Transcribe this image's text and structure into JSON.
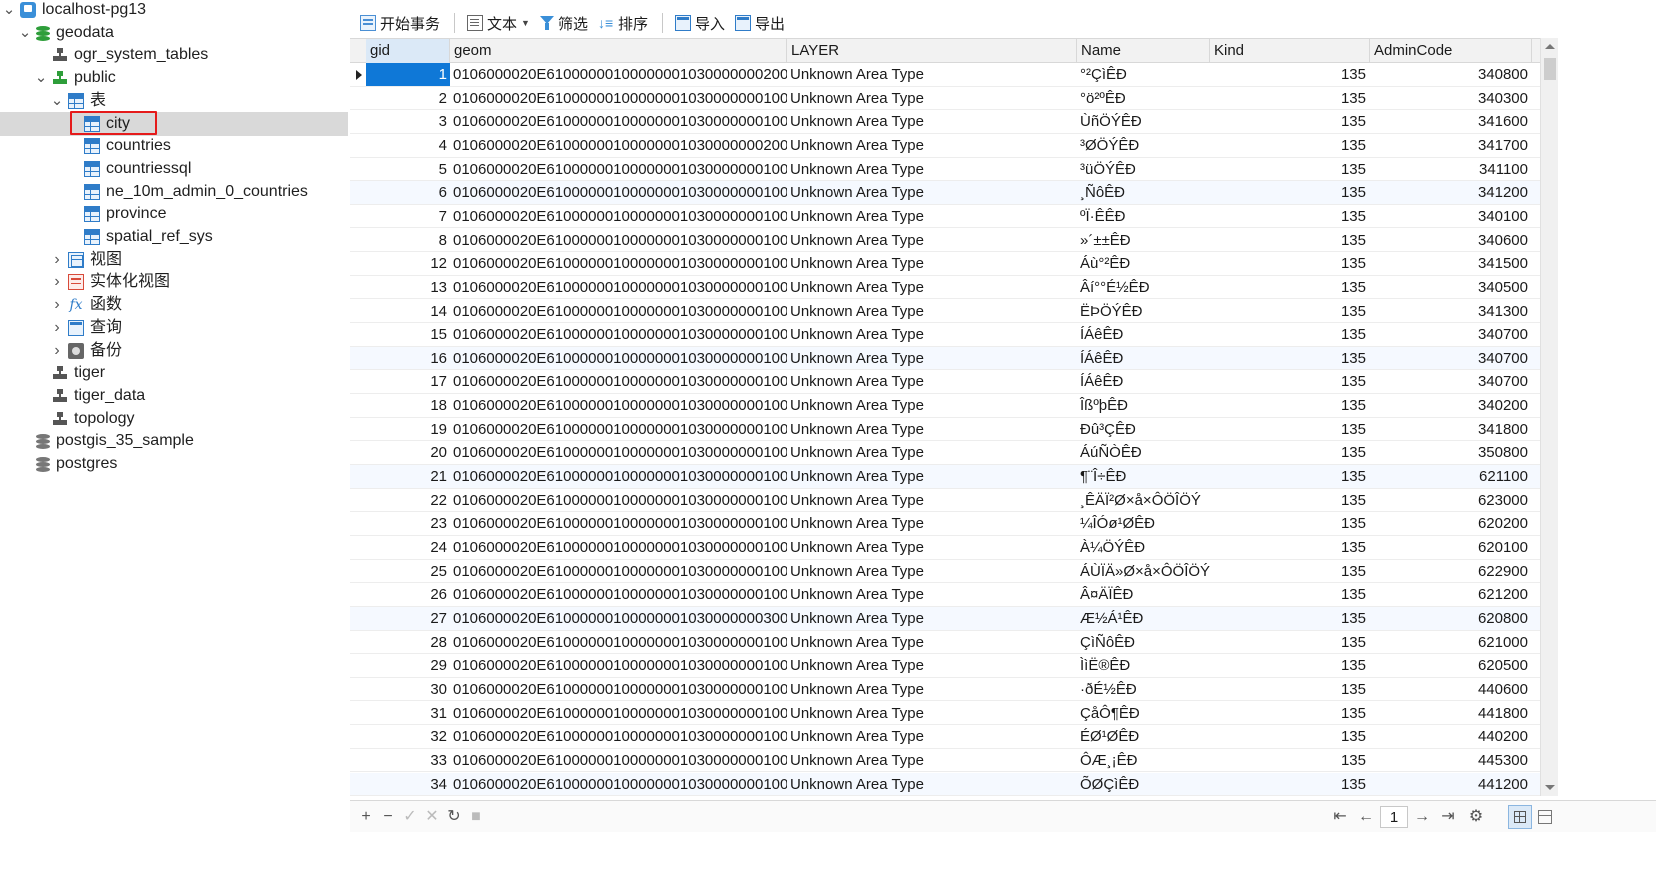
{
  "tree": [
    {
      "label": "localhost-pg13",
      "icon": "server-icon",
      "level": 0,
      "expanded": true
    },
    {
      "label": "geodata",
      "icon": "database-icon",
      "level": 1,
      "expanded": true,
      "color": "#2e9e3a"
    },
    {
      "label": "ogr_system_tables",
      "icon": "schema-icon",
      "level": 2,
      "expanded": null,
      "color": "#555555"
    },
    {
      "label": "public",
      "icon": "schema-icon",
      "level": 2,
      "expanded": true,
      "color": "#2e9e3a"
    },
    {
      "label": "表",
      "icon": "tables-folder-icon",
      "level": 3,
      "expanded": true
    },
    {
      "label": "city",
      "icon": "table-icon",
      "level": 4,
      "expanded": null,
      "selected": true
    },
    {
      "label": "countries",
      "icon": "table-icon",
      "level": 4,
      "expanded": null
    },
    {
      "label": "countriessql",
      "icon": "table-icon",
      "level": 4,
      "expanded": null
    },
    {
      "label": "ne_10m_admin_0_countries",
      "icon": "table-icon",
      "level": 4,
      "expanded": null
    },
    {
      "label": "province",
      "icon": "table-icon",
      "level": 4,
      "expanded": null
    },
    {
      "label": "spatial_ref_sys",
      "icon": "table-icon",
      "level": 4,
      "expanded": null
    },
    {
      "label": "视图",
      "icon": "view-icon",
      "level": 3,
      "expanded": false
    },
    {
      "label": "实体化视图",
      "icon": "materialized-view-icon",
      "level": 3,
      "expanded": false
    },
    {
      "label": "函数",
      "icon": "function-icon",
      "level": 3,
      "expanded": false
    },
    {
      "label": "查询",
      "icon": "query-icon",
      "level": 3,
      "expanded": false
    },
    {
      "label": "备份",
      "icon": "backup-icon",
      "level": 3,
      "expanded": false
    },
    {
      "label": "tiger",
      "icon": "schema-icon",
      "level": 2,
      "expanded": null,
      "color": "#555555"
    },
    {
      "label": "tiger_data",
      "icon": "schema-icon",
      "level": 2,
      "expanded": null,
      "color": "#555555"
    },
    {
      "label": "topology",
      "icon": "schema-icon",
      "level": 2,
      "expanded": null,
      "color": "#555555"
    },
    {
      "label": "postgis_35_sample",
      "icon": "database-icon",
      "level": 1,
      "expanded": null,
      "color": "#777777"
    },
    {
      "label": "postgres",
      "icon": "database-icon",
      "level": 1,
      "expanded": null,
      "color": "#777777"
    }
  ],
  "toolbar": {
    "begin_transaction": "开始事务",
    "text": "文本",
    "filter": "筛选",
    "sort": "排序",
    "import": "导入",
    "export": "导出"
  },
  "columns": [
    "gid",
    "geom",
    "LAYER",
    "Name",
    "Kind",
    "AdminCode"
  ],
  "rows": [
    [
      "1",
      "0106000020E61000000100000001030000000200",
      "Unknown Area Type",
      "°²ÇìÊÐ",
      "135",
      "340800"
    ],
    [
      "2",
      "0106000020E61000000100000001030000000100",
      "Unknown Area Type",
      "°ö²ºÊÐ",
      "135",
      "340300"
    ],
    [
      "3",
      "0106000020E61000000100000001030000000100",
      "Unknown Area Type",
      "ÙñÖÝÊÐ",
      "135",
      "341600"
    ],
    [
      "4",
      "0106000020E61000000100000001030000000200",
      "Unknown Area Type",
      "³ØÖÝÊÐ",
      "135",
      "341700"
    ],
    [
      "5",
      "0106000020E61000000100000001030000000100",
      "Unknown Area Type",
      "³üÖÝÊÐ",
      "135",
      "341100"
    ],
    [
      "6",
      "0106000020E61000000100000001030000000100",
      "Unknown Area Type",
      "¸ÑôÊÐ",
      "135",
      "341200"
    ],
    [
      "7",
      "0106000020E61000000100000001030000000100",
      "Unknown Area Type",
      "ºÏ·ÊÊÐ",
      "135",
      "340100"
    ],
    [
      "8",
      "0106000020E61000000100000001030000000100",
      "Unknown Area Type",
      "»´±±ÊÐ",
      "135",
      "340600"
    ],
    [
      "12",
      "0106000020E61000000100000001030000000100",
      "Unknown Area Type",
      "Áù°²ÊÐ",
      "135",
      "341500"
    ],
    [
      "13",
      "0106000020E61000000100000001030000000100",
      "Unknown Area Type",
      "Âí°°É½ÊÐ",
      "135",
      "340500"
    ],
    [
      "14",
      "0106000020E61000000100000001030000000100",
      "Unknown Area Type",
      "ËÞÖÝÊÐ",
      "135",
      "341300"
    ],
    [
      "15",
      "0106000020E61000000100000001030000000100",
      "Unknown Area Type",
      "Í­ÁêÊÐ",
      "135",
      "340700"
    ],
    [
      "16",
      "0106000020E61000000100000001030000000100",
      "Unknown Area Type",
      "Í­ÁêÊÐ",
      "135",
      "340700"
    ],
    [
      "17",
      "0106000020E61000000100000001030000000100",
      "Unknown Area Type",
      "Í­ÁêÊÐ",
      "135",
      "340700"
    ],
    [
      "18",
      "0106000020E61000000100000001030000000100",
      "Unknown Area Type",
      "ÎßºþÊÐ",
      "135",
      "340200"
    ],
    [
      "19",
      "0106000020E61000000100000001030000000100",
      "Unknown Area Type",
      "Ðû³ÇÊÐ",
      "135",
      "341800"
    ],
    [
      "20",
      "0106000020E61000000100000001030000000100",
      "Unknown Area Type",
      "ÁúÑÒÊÐ",
      "135",
      "350800"
    ],
    [
      "21",
      "0106000020E61000000100000001030000000100",
      "Unknown Area Type",
      "¶¨Î÷ÊÐ",
      "135",
      "621100"
    ],
    [
      "22",
      "0106000020E61000000100000001030000000100",
      "Unknown Area Type",
      "¸ÊÄÏ²Ø×å×ÔÖÎÖÝ",
      "135",
      "623000"
    ],
    [
      "23",
      "0106000020E61000000100000001030000000100",
      "Unknown Area Type",
      "¼ÎÓø¹ØÊÐ",
      "135",
      "620200"
    ],
    [
      "24",
      "0106000020E61000000100000001030000000100",
      "Unknown Area Type",
      "À¼ÖÝÊÐ",
      "135",
      "620100"
    ],
    [
      "25",
      "0106000020E61000000100000001030000000100",
      "Unknown Area Type",
      "ÁÙÏÄ»Ø×å×ÔÖÎÖÝ",
      "135",
      "622900"
    ],
    [
      "26",
      "0106000020E61000000100000001030000000100",
      "Unknown Area Type",
      "Â¤ÄÏÊÐ",
      "135",
      "621200"
    ],
    [
      "27",
      "0106000020E61000000100000001030000000300",
      "Unknown Area Type",
      "Æ½Á¹ÊÐ",
      "135",
      "620800"
    ],
    [
      "28",
      "0106000020E61000000100000001030000000100",
      "Unknown Area Type",
      "ÇìÑôÊÐ",
      "135",
      "621000"
    ],
    [
      "29",
      "0106000020E61000000100000001030000000100",
      "Unknown Area Type",
      "ÌìË®ÊÐ",
      "135",
      "620500"
    ],
    [
      "30",
      "0106000020E61000000100000001030000000100",
      "Unknown Area Type",
      "·ðÉ½ÊÐ",
      "135",
      "440600"
    ],
    [
      "31",
      "0106000020E61000000100000001030000000100",
      "Unknown Area Type",
      "ÇåÔ¶ÊÐ",
      "135",
      "441800"
    ],
    [
      "32",
      "0106000020E61000000100000001030000000100",
      "Unknown Area Type",
      "ÉØ¹ØÊÐ",
      "135",
      "440200"
    ],
    [
      "33",
      "0106000020E61000000100000001030000000100",
      "Unknown Area Type",
      "ÔÆ¸¡ÊÐ",
      "135",
      "445300"
    ],
    [
      "34",
      "0106000020E61000000100000001030000000100",
      "Unknown Area Type",
      "ÕØÇìÊÐ",
      "135",
      "441200"
    ]
  ],
  "current_row": 0,
  "pagination": {
    "page": "1"
  },
  "bottom_icons": [
    "add-record",
    "delete-record",
    "apply-changes",
    "discard-changes",
    "refresh",
    "stop"
  ],
  "colors": {
    "selection": "#0f78d7",
    "highlight_box": "#e51b1b",
    "tree_selected": "#d9d9d9"
  }
}
